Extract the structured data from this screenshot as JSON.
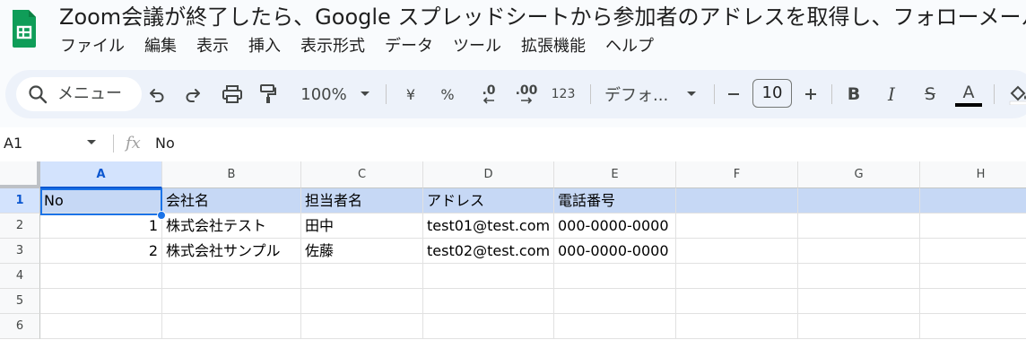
{
  "doc": {
    "title": "Zoom会議が終了したら、Google スプレッドシートから参加者のアドレスを取得し、フォローメール"
  },
  "menu": [
    "ファイル",
    "編集",
    "表示",
    "挿入",
    "表示形式",
    "データ",
    "ツール",
    "拡張機能",
    "ヘルプ"
  ],
  "toolbar": {
    "search_label": "メニュー",
    "zoom": "100%",
    "currency": "¥",
    "percent": "%",
    "dec_decrease": ".0",
    "dec_increase": ".00",
    "number_format": "123",
    "font": "デフォ...",
    "font_size": "10",
    "bold": "B",
    "italic": "I",
    "strike": "S",
    "text_color_letter": "A",
    "text_color": "#000000",
    "icons": [
      "search-icon",
      "undo-icon",
      "redo-icon",
      "print-icon",
      "paint-format-icon",
      "dropdown-icon",
      "minus-icon",
      "plus-icon",
      "fill-color-icon"
    ]
  },
  "formula_bar": {
    "cell_ref": "A1",
    "fx": "fx",
    "value": "No"
  },
  "sheet": {
    "columns": [
      "A",
      "B",
      "C",
      "D",
      "E",
      "F",
      "G",
      "H"
    ],
    "rows": [
      "1",
      "2",
      "3",
      "4",
      "5",
      "6"
    ],
    "selected_cell": "A1",
    "header_fill": "#c6d8f5",
    "cells": [
      [
        "No",
        "会社名",
        "担当者名",
        "アドレス",
        "電話番号",
        "",
        "",
        ""
      ],
      [
        "1",
        "株式会社テスト",
        "田中",
        "test01@test.com",
        "000-0000-0000",
        "",
        "",
        ""
      ],
      [
        "2",
        "株式会社サンプル",
        "佐藤",
        "test02@test.com",
        "000-0000-0000",
        "",
        "",
        ""
      ],
      [
        "",
        "",
        "",
        "",
        "",
        "",
        "",
        ""
      ],
      [
        "",
        "",
        "",
        "",
        "",
        "",
        "",
        ""
      ],
      [
        "",
        "",
        "",
        "",
        "",
        "",
        "",
        ""
      ]
    ]
  },
  "colors": {
    "accent": "#1a73e8",
    "toolbar_bg": "#edf2fa",
    "sheets_green": "#0f9d58"
  }
}
